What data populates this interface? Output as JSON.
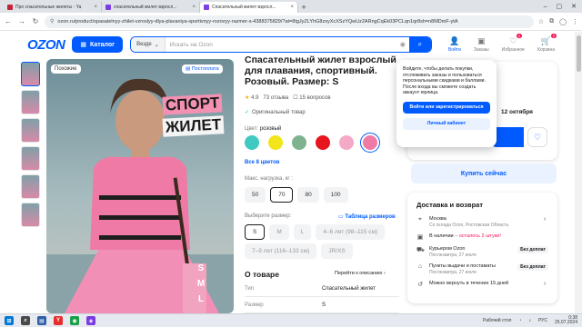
{
  "browser": {
    "tabs": [
      {
        "title": "Про спасательные жилеты - Ya",
        "color": "#c4233a"
      },
      {
        "title": "спасательный жилет взросл...",
        "color": "#7b3fe4"
      },
      {
        "title": "Спасательный жилет взросл...",
        "color": "#7b3fe4"
      }
    ],
    "url": "ozon.ru/product/spasatelnyy-zhilet-vzroslyy-dlya-plavaniya-sportivnyy-rozovyy-razmer-s-4388375829/?at=8tgJyZLYhG8zxyXcXSzYQwUz2ARngCqEk03PCLqn1qr8sh=n8MDmF-ytA"
  },
  "header": {
    "logo": "OZON",
    "catalog": "Каталог",
    "search_scope": "Везде",
    "search_placeholder": "Искать на Ozon",
    "icons": [
      {
        "label": "Войти",
        "glyph": "👤",
        "badge": ""
      },
      {
        "label": "Заказы",
        "glyph": "▣",
        "badge": ""
      },
      {
        "label": "Избранное",
        "glyph": "♡",
        "badge": "1"
      },
      {
        "label": "Корзина",
        "glyph": "🛒",
        "badge": "2"
      }
    ]
  },
  "image": {
    "badge_left": "Похожие",
    "badge_right": "Постоплата",
    "overlay_line1": "СПОРТ",
    "overlay_line2": "ЖИЛЕТ",
    "size_letters": [
      "S",
      "M",
      "L"
    ]
  },
  "product": {
    "title": "Спасательный жилет взрослый для плавания, спортивный. Розовый. Размер: S",
    "rating": "4.9",
    "reviews": "73 отзыва",
    "questions": "15 вопросов",
    "original": "Оригинальный товар",
    "color_label": "Цвет:",
    "color_value": "розовый",
    "colors": [
      "#3fc9c0",
      "#f2e51b",
      "#7fb38f",
      "#e8141e",
      "#f4a9c6",
      "#f07aa6"
    ],
    "selected_color": 5,
    "all_colors": "Все 8 цветов",
    "load_label": "Макс. нагрузка, кг :",
    "loads": [
      "50",
      "70",
      "80",
      "100"
    ],
    "selected_load": 1,
    "size_label": "Выберите размер:",
    "size_table": "Таблица размеров",
    "sizes_row1": [
      "S",
      "M",
      "L",
      "4–6 лет (98–115 см)"
    ],
    "sizes_row2": [
      "7–9 лет (116–133 см)",
      "JR/XS"
    ],
    "about": "О товаре",
    "about_link": "Перейти к описанию",
    "specs": [
      {
        "k": "Тип",
        "v": "Спасательный жилет"
      },
      {
        "k": "Размер",
        "v": "S"
      }
    ]
  },
  "buy": {
    "date": "12 октября",
    "buy_now": "Купить сейчас"
  },
  "popup": {
    "text": "Войдите, чтобы делать покупки, отслеживать заказы и пользоваться персональными скидками и баллами. После входа вы сможете создать аккаунт юрлица.",
    "primary": "Войти или зарегистрироваться",
    "secondary": "Личный кабинет"
  },
  "delivery": {
    "title": "Доставка и возврат",
    "city": "Москва",
    "city_sub": "Со склада Ozon, Ростовская Область",
    "stock": "В наличии",
    "stock_left": "– осталось 2 штуки!",
    "courier": "Курьером Ozon",
    "courier_sub": "Послезавтра, 27 июля",
    "courier_tag": "Без доплат",
    "pickup": "Пункты выдачи и постаматы",
    "pickup_sub": "Послезавтра, 27 июля",
    "pickup_tag": "Без доплат",
    "return": "Можно вернуть в течение 15 дней"
  },
  "taskbar": {
    "lang": "РУС",
    "time": "0:38",
    "date": "25.07.2024",
    "weather": "Рабочий стол"
  }
}
